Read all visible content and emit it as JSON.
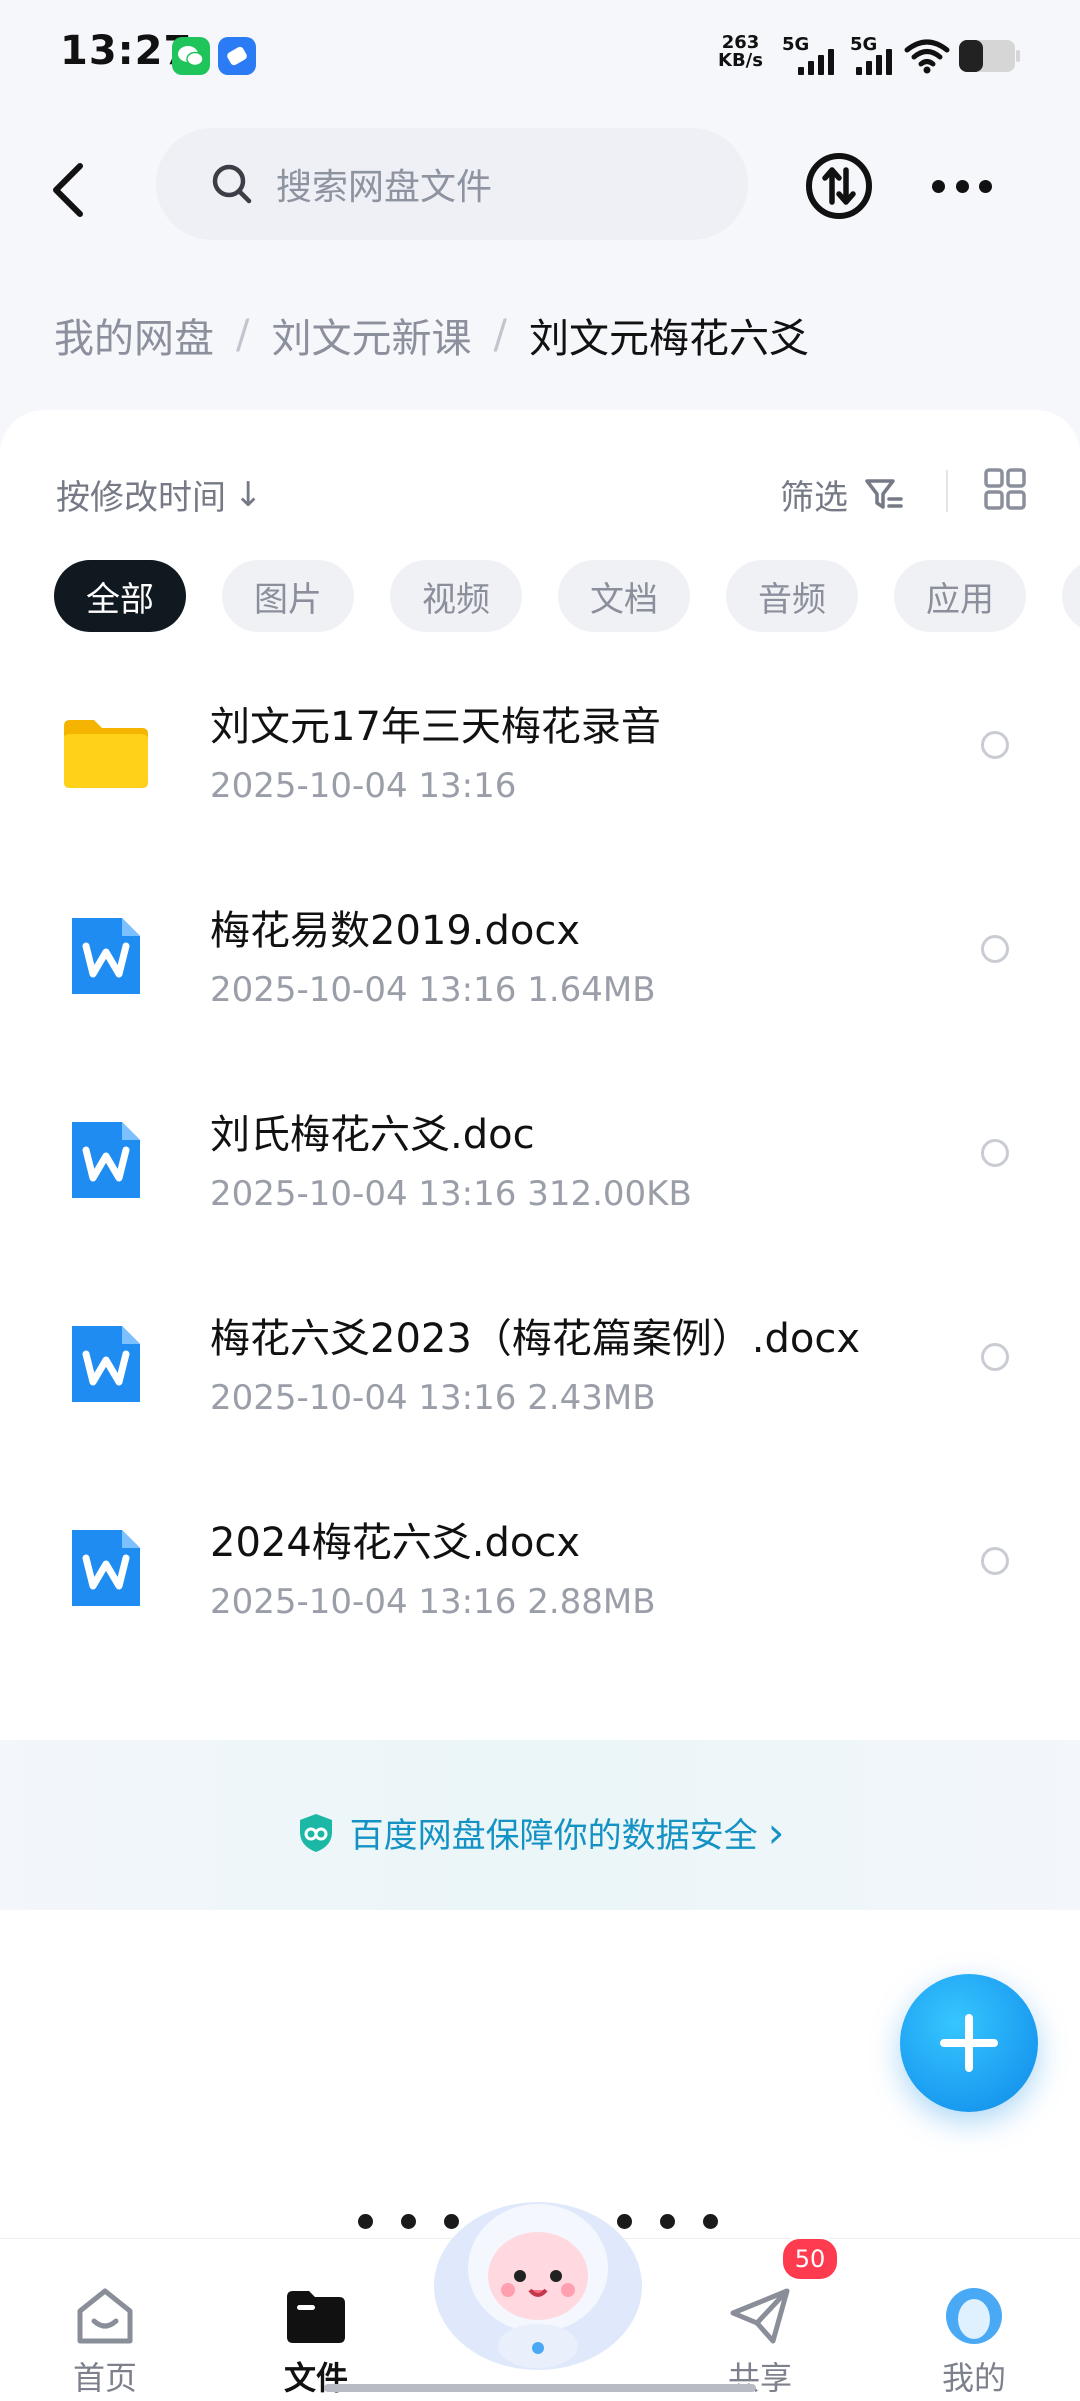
{
  "status_bar": {
    "time": "13:27",
    "net_speed_value": "263",
    "net_speed_unit": "KB/s",
    "sim1": "5G",
    "sim2": "5G",
    "icons": [
      "wechat-icon",
      "app-icon",
      "wifi-icon",
      "battery-icon"
    ]
  },
  "top_bar": {
    "search_placeholder": "搜索网盘文件",
    "icons": [
      "back-icon",
      "search-icon",
      "transfer-icon",
      "more-icon"
    ]
  },
  "breadcrumb": {
    "items": [
      "我的网盘",
      "刘文元新课",
      "刘文元梅花六爻"
    ]
  },
  "toolbar": {
    "sort_label": "按修改时间",
    "sort_arrow": "↓",
    "filter_label": "筛选"
  },
  "chips": [
    "全部",
    "图片",
    "视频",
    "文档",
    "音频",
    "应用"
  ],
  "files": [
    {
      "name": "刘文元17年三天梅花录音",
      "meta": "2025-10-04  13:16",
      "type": "folder"
    },
    {
      "name": "梅花易数2019.docx",
      "meta": "2025-10-04  13:16  1.64MB",
      "type": "word"
    },
    {
      "name": "刘氏梅花六爻.doc",
      "meta": "2025-10-04  13:16  312.00KB",
      "type": "word"
    },
    {
      "name": "梅花六爻2023（梅花篇案例）.docx",
      "meta": "2025-10-04  13:16  2.43MB",
      "type": "word"
    },
    {
      "name": "2024梅花六爻.docx",
      "meta": "2025-10-04  13:16  2.88MB",
      "type": "word"
    }
  ],
  "banner": {
    "text": "百度网盘保障你的数据安全",
    "chevron": "›"
  },
  "bottom_nav": {
    "items": [
      {
        "label": "首页",
        "icon": "home-icon"
      },
      {
        "label": "文件",
        "icon": "folder-icon"
      },
      {
        "label": "共享",
        "icon": "share-icon"
      },
      {
        "label": "我的",
        "icon": "profile-icon"
      }
    ],
    "share_badge": "50",
    "active": "文件"
  },
  "colors": {
    "accent": "#1a9bf0",
    "banner_text": "#1592c4",
    "active_chip": "#101820",
    "badge": "#ff3b4f"
  }
}
